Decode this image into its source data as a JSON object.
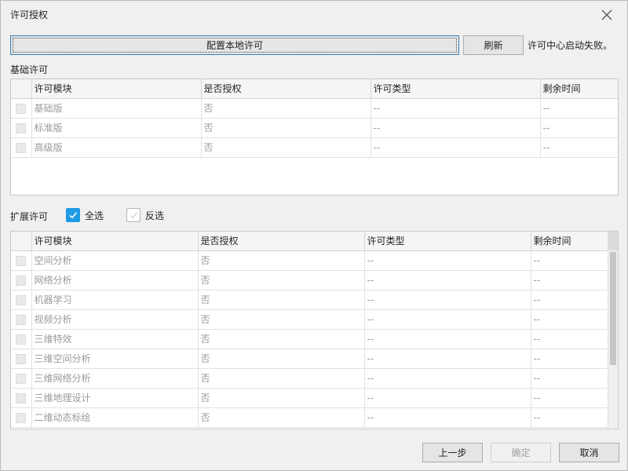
{
  "window": {
    "title": "许可授权"
  },
  "icons": {
    "close": "close-icon",
    "check": "check-icon"
  },
  "colors": {
    "accent": "#1f9be3"
  },
  "toolbar": {
    "configure_label": "配置本地许可",
    "refresh_label": "刷新",
    "status_text": "许可中心启动失败。"
  },
  "basic": {
    "section_label": "基础许可",
    "columns": [
      "许可模块",
      "是否授权",
      "许可类型",
      "剩余时间"
    ],
    "rows": [
      [
        "基础版",
        "否",
        "--",
        "--"
      ],
      [
        "标准版",
        "否",
        "--",
        "--"
      ],
      [
        "高级版",
        "否",
        "--",
        "--"
      ]
    ]
  },
  "extension": {
    "section_label": "扩展许可",
    "select_all_label": "全选",
    "select_all_checked": true,
    "invert_label": "反选",
    "invert_checked": false,
    "columns": [
      "许可模块",
      "是否授权",
      "许可类型",
      "剩余时间"
    ],
    "rows": [
      [
        "空间分析",
        "否",
        "--",
        "--"
      ],
      [
        "网络分析",
        "否",
        "--",
        "--"
      ],
      [
        "机器学习",
        "否",
        "--",
        "--"
      ],
      [
        "视频分析",
        "否",
        "--",
        "--"
      ],
      [
        "三维特效",
        "否",
        "--",
        "--"
      ],
      [
        "三维空间分析",
        "否",
        "--",
        "--"
      ],
      [
        "三维网络分析",
        "否",
        "--",
        "--"
      ],
      [
        "三维地理设计",
        "否",
        "--",
        "--"
      ],
      [
        "二维动态标绘",
        "否",
        "--",
        "--"
      ]
    ]
  },
  "footer": {
    "prev_label": "上一步",
    "ok_label": "确定",
    "cancel_label": "取消"
  }
}
